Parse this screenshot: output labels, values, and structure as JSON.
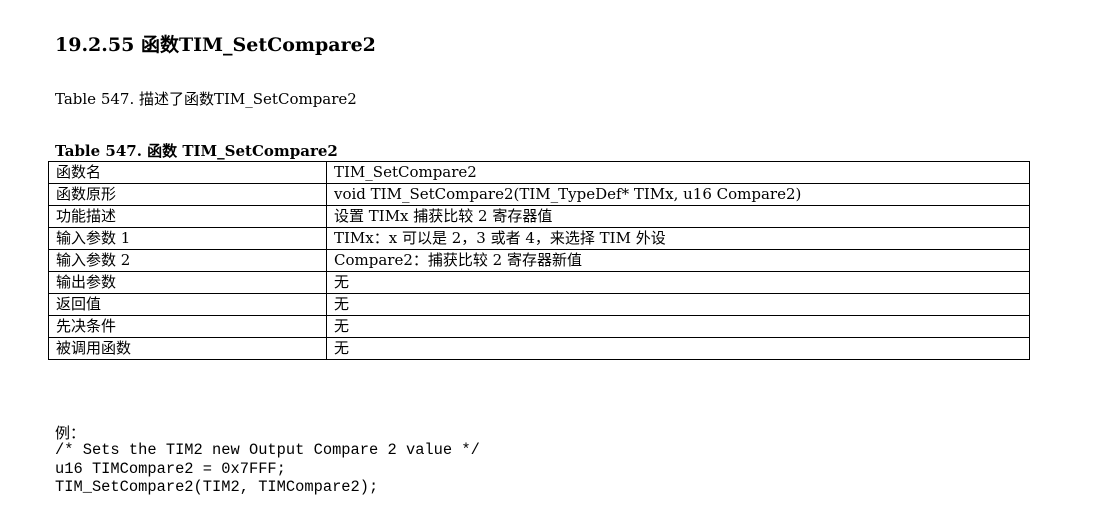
{
  "heading": "19.2.55 函数TIM_SetCompare2",
  "intro": "Table 547. 描述了函数TIM_SetCompare2",
  "caption": "Table 547. 函数 TIM_SetCompare2",
  "table": {
    "rows": [
      {
        "key": "函数名",
        "value": "TIM_SetCompare2"
      },
      {
        "key": "函数原形",
        "value": "void TIM_SetCompare2(TIM_TypeDef* TIMx, u16 Compare2)"
      },
      {
        "key": "功能描述",
        "value": "设置 TIMx 捕获比较 2 寄存器值"
      },
      {
        "key": "输入参数 1",
        "value": "TIMx：x 可以是 2，3 或者 4，来选择 TIM 外设"
      },
      {
        "key": "输入参数 2",
        "value": "Compare2：捕获比较 2 寄存器新值"
      },
      {
        "key": "输出参数",
        "value": "无"
      },
      {
        "key": "返回值",
        "value": "无"
      },
      {
        "key": "先决条件",
        "value": "无"
      },
      {
        "key": "被调用函数",
        "value": "无"
      }
    ]
  },
  "example": {
    "label": "例：",
    "code": [
      "/* Sets the TIM2 new Output Compare 2 value */",
      "u16 TIMCompare2 = 0x7FFF;",
      "TIM_SetCompare2(TIM2, TIMCompare2);"
    ]
  }
}
